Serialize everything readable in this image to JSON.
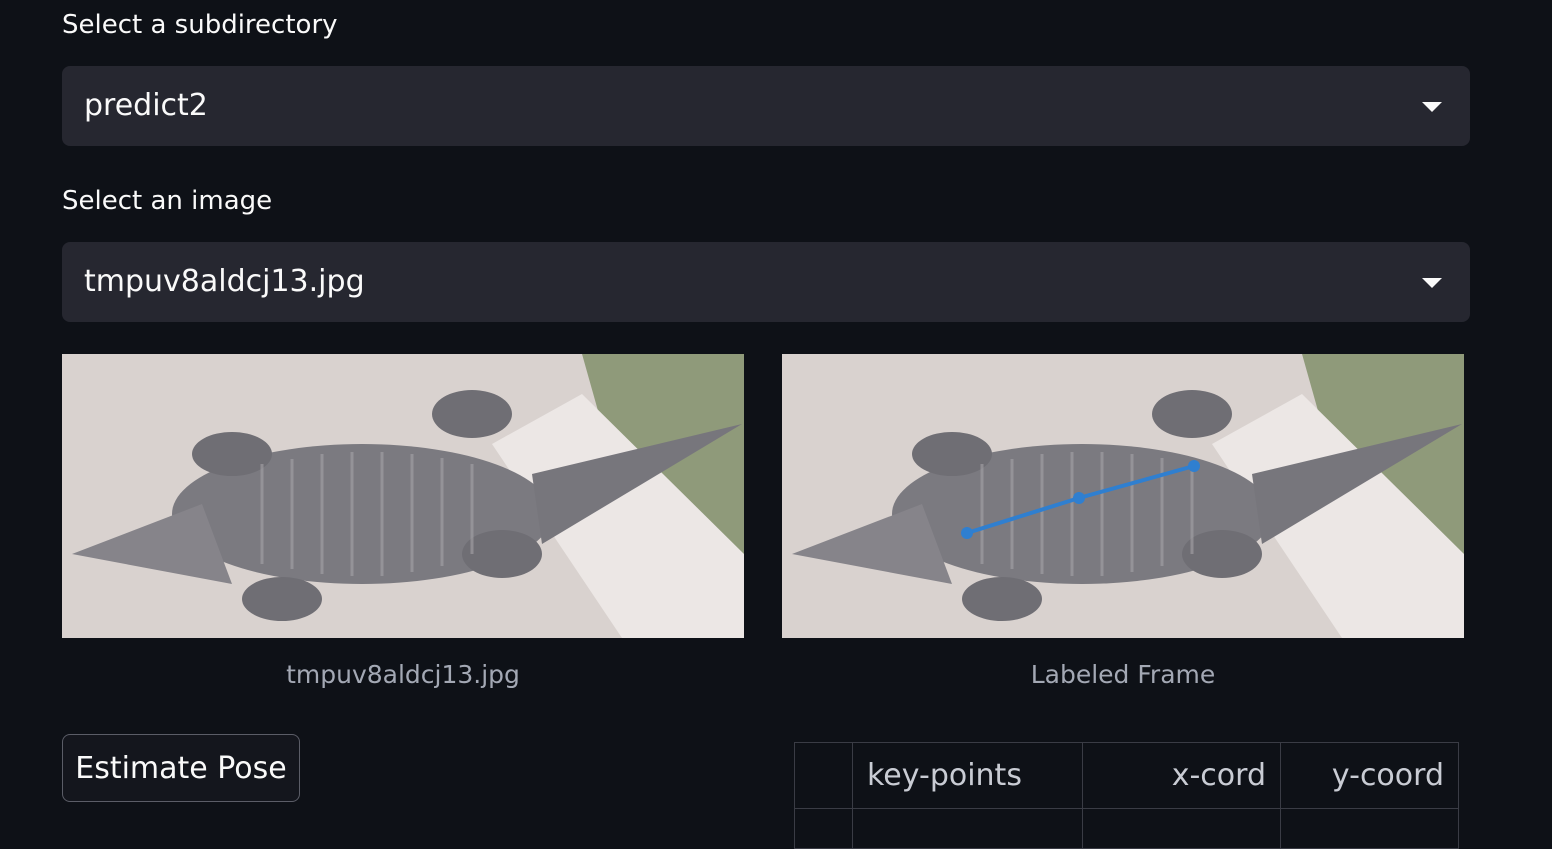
{
  "subdirectory": {
    "label": "Select a subdirectory",
    "value": "predict2"
  },
  "image_select": {
    "label": "Select an image",
    "value": "tmpuv8aldcj13.jpg"
  },
  "left_image": {
    "caption": "tmpuv8aldcj13.jpg"
  },
  "right_image": {
    "caption": "Labeled Frame",
    "keypoint_color": "#2f7fd0"
  },
  "estimate_button": {
    "label": "Estimate Pose"
  },
  "table": {
    "headers": [
      "",
      "key-points",
      "x-cord",
      "y-coord"
    ]
  }
}
